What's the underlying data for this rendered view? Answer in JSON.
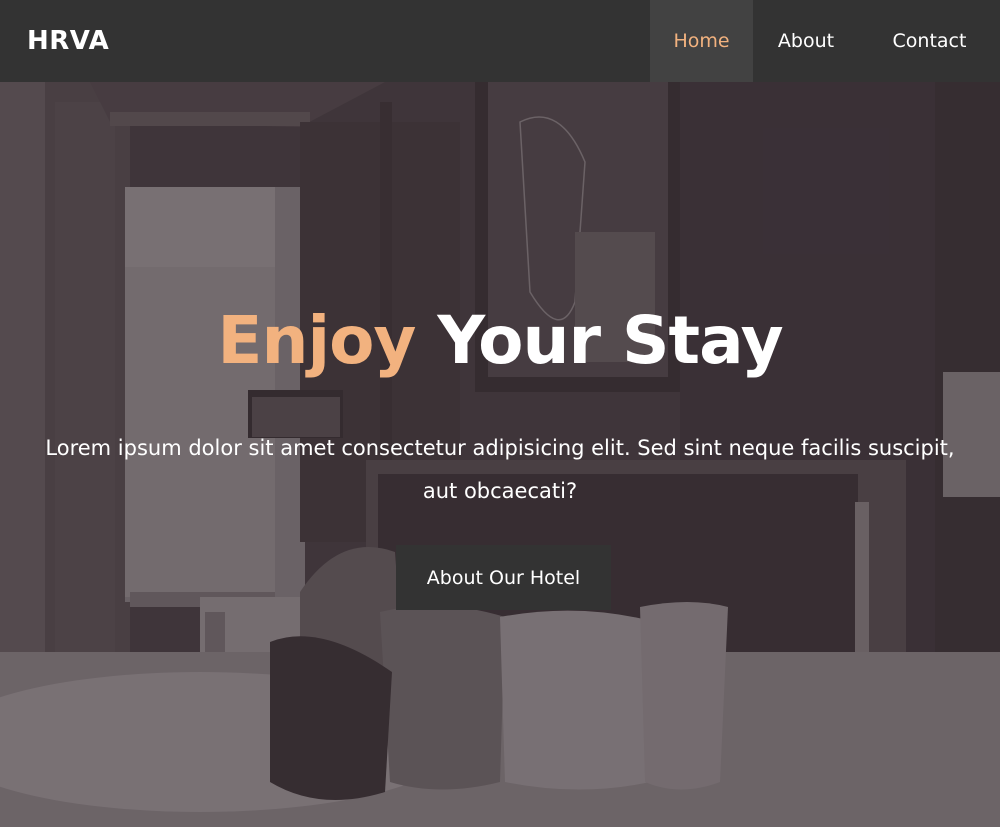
{
  "nav": {
    "brand": "HRVA",
    "items": [
      {
        "label": "Home",
        "active": true
      },
      {
        "label": "About",
        "active": false
      },
      {
        "label": "Contact",
        "active": false
      }
    ]
  },
  "hero": {
    "headline_accent": "Enjoy",
    "headline_rest": " Your Stay",
    "subtitle": "Lorem ipsum dolor sit amet consectetur adipisicing elit. Sed sint neque facilis suscipit, aut obcaecati?",
    "cta_label": "About Our Hotel",
    "background_icon": "hotel-room-photo"
  },
  "colors": {
    "nav_bg": "#333333",
    "nav_active_bg": "#424242",
    "accent": "#f2b27f",
    "text": "#ffffff",
    "overlay": "#4a3f44"
  }
}
